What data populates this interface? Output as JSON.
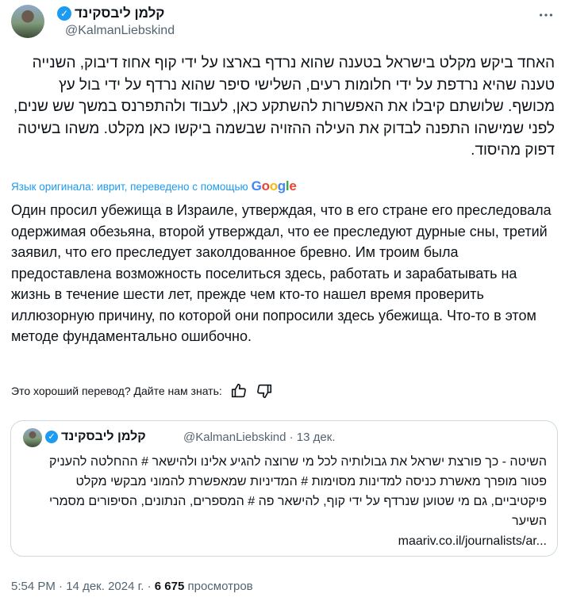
{
  "author": {
    "name": "קלמן ליבסקינד",
    "handle": "@KalmanLiebskind",
    "verified_icon": "verified-badge-icon"
  },
  "more_icon": "more-horizontal-icon",
  "original_text": "האחד ביקש מקלט בישראל בטענה שהוא נרדף בארצו על ידי קוף אחוז דיבוק, השנייה טענה שהיא נרדפת על ידי חלומות רעים, השלישי סיפר שהוא נרדף על ידי בול עץ מכושף. שלושתם קיבלו את האפשרות להשתקע כאן, לעבוד ולהתפרנס במשך שש שנים, לפני שמישהו התפנה לבדוק את העילה ההזויה שבשמה ביקשו כאן מקלט. משהו בשיטה דפוק מהיסוד.",
  "translation_note": "Язык оригинала: иврит, переведено с помощью",
  "google_logo": [
    "G",
    "o",
    "o",
    "g",
    "l",
    "e"
  ],
  "translated_text": "Один просил убежища в Израиле, утверждая, что в его стране его преследовала одержимая обезьяна, второй утверждал, что ее преследуют дурные сны, третий заявил, что его преследует заколдованное бревно. Им троим была предоставлена возможность поселиться здесь, работать и зарабатывать на жизнь в течение шести лет, прежде чем кто-то нашел время проверить иллюзорную причину, по которой они попросили здесь убежища. Что-то в этом методе фундаментально ошибочно.",
  "feedback": {
    "label": "Это хороший перевод? Дайте нам знать:",
    "like_icon": "thumbs-up-icon",
    "dislike_icon": "thumbs-down-icon"
  },
  "quoted": {
    "name": "קלמן ליבסקינד",
    "handle": "@KalmanLiebskind",
    "date": "· 13 дек.",
    "text": "השיטה - כך פורצת ישראל את גבולותיה לכל מי שרוצה להגיע אלינו ולהישאר # ההחלטה להעניק פטור מופרך מאשרת כניסה למדינות מסוימות # המדיניות שמאפשרת להמוני מבקשי מקלט פיקטיביים, גם מי שטוען שנרדף על ידי קוף, להישאר פה # המספרים, הנתונים, הסיפורים מסמרי השיער",
    "link": "maariv.co.il/journalists/ar..."
  },
  "footer": {
    "time": "5:54 PM",
    "sep1": " · ",
    "date": "14 дек. 2024 г.",
    "sep2": " · ",
    "views": "6 675",
    "views_label": " просмотров"
  }
}
